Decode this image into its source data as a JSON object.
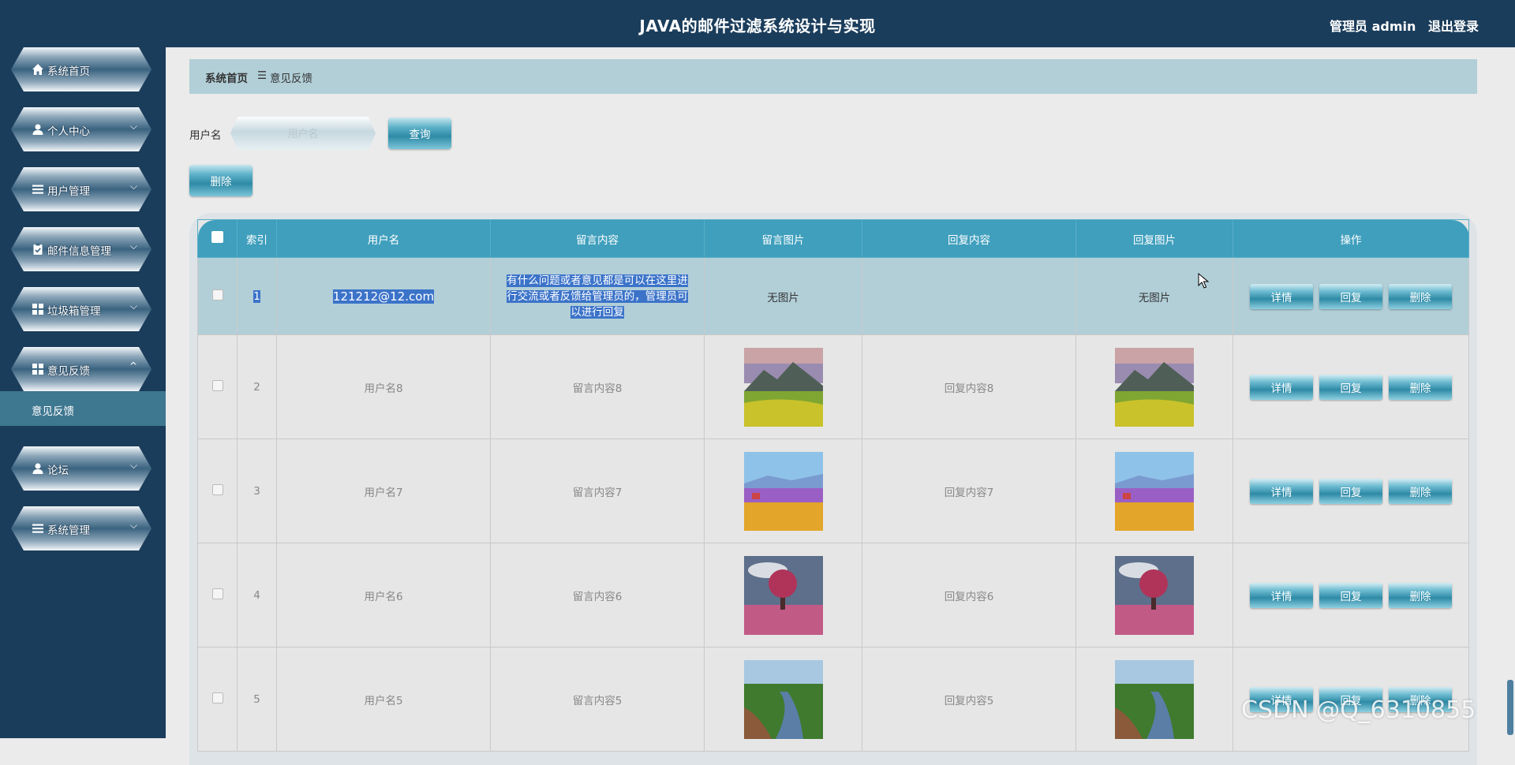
{
  "header": {
    "title": "JAVA的邮件过滤系统设计与实现",
    "user_label": "管理员 admin",
    "logout_label": "退出登录"
  },
  "sidebar": {
    "items": [
      {
        "label": "系统首页",
        "icon": "home-icon",
        "chevron": ""
      },
      {
        "label": "个人中心",
        "icon": "user-icon",
        "chevron": "⌵"
      },
      {
        "label": "用户管理",
        "icon": "list-icon",
        "chevron": "⌵"
      },
      {
        "label": "邮件信息管理",
        "icon": "clipboard-icon",
        "chevron": "⌵"
      },
      {
        "label": "垃圾箱管理",
        "icon": "grid-icon",
        "chevron": "⌵"
      },
      {
        "label": "意见反馈",
        "icon": "grid-icon",
        "chevron": "^"
      },
      {
        "label": "论坛",
        "icon": "user-icon",
        "chevron": "⌵"
      },
      {
        "label": "系统管理",
        "icon": "list-icon",
        "chevron": "⌵"
      }
    ],
    "submenu_label": "意见反馈"
  },
  "breadcrumb": {
    "home": "系统首页",
    "separator": "☰",
    "current": "意见反馈"
  },
  "search": {
    "label": "用户名",
    "placeholder": "用户名",
    "value": "",
    "query_label": "查询",
    "delete_label": "删除"
  },
  "table": {
    "columns": [
      "索引",
      "用户名",
      "留言内容",
      "留言图片",
      "回复内容",
      "回复图片",
      "操作"
    ],
    "no_image_label": "无图片",
    "rows": [
      {
        "index": "1",
        "username": "121212@12.com",
        "content": "有什么问题或者意见都是可以在这里进行交流或者反馈给管理员的，管理员可以进行回复",
        "image": "",
        "reply": "",
        "reply_image": ""
      },
      {
        "index": "2",
        "username": "用户名8",
        "content": "留言内容8",
        "image": "mountain-meadow",
        "reply": "回复内容8",
        "reply_image": "mountain-meadow"
      },
      {
        "index": "3",
        "username": "用户名7",
        "content": "留言内容7",
        "image": "flower-field",
        "reply": "回复内容7",
        "reply_image": "flower-field"
      },
      {
        "index": "4",
        "username": "用户名6",
        "content": "留言内容6",
        "image": "pink-tree",
        "reply": "回复内容6",
        "reply_image": "pink-tree"
      },
      {
        "index": "5",
        "username": "用户名5",
        "content": "留言内容5",
        "image": "river-forest",
        "reply": "回复内容5",
        "reply_image": "river-forest"
      }
    ],
    "actions": {
      "detail": "详情",
      "reply": "回复",
      "delete": "删除"
    }
  },
  "watermark": "CSDN @Q_6310855",
  "colors": {
    "header_bg": "#1b3d5c",
    "table_header": "#3f9fbd",
    "breadcrumb_bg": "#b2cfd8",
    "selection": "#3b73c9"
  }
}
